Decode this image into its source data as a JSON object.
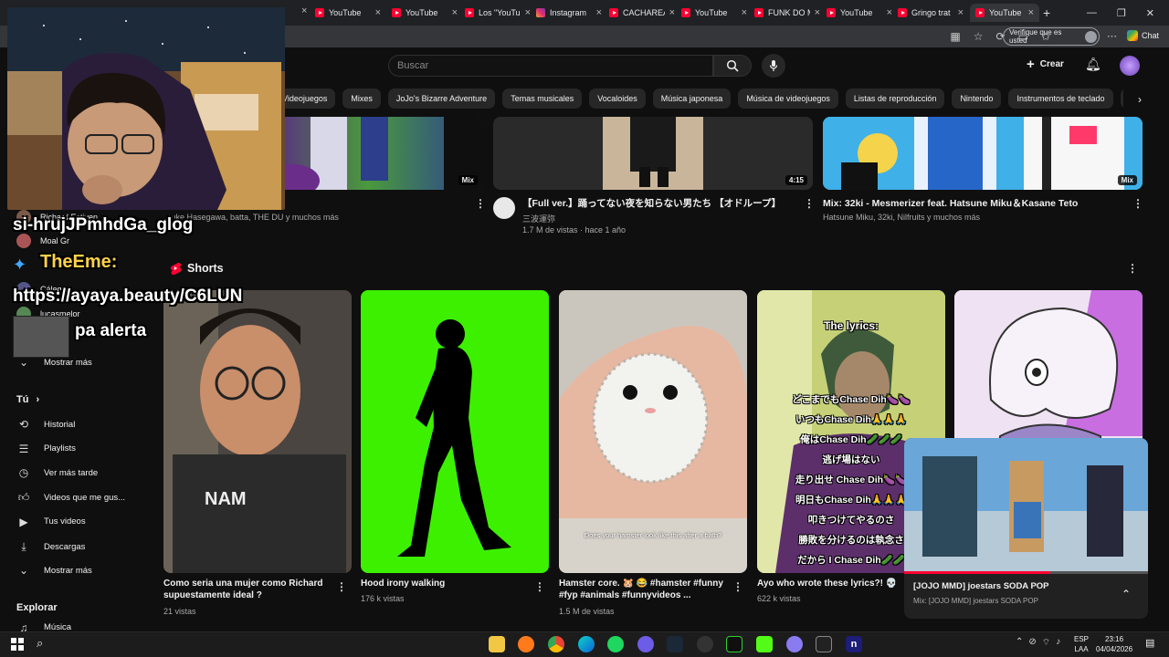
{
  "browser": {
    "tabs": [
      {
        "label": "YouTube",
        "favicon": "youtube-icon"
      },
      {
        "label": "YouTube",
        "favicon": "youtube-icon"
      },
      {
        "label": "Los \"YouTu",
        "favicon": "youtube-icon"
      },
      {
        "label": "Instagram",
        "favicon": "instagram-icon"
      },
      {
        "label": "CACHAREA",
        "favicon": "youtube-icon"
      },
      {
        "label": "YouTube",
        "favicon": "youtube-icon"
      },
      {
        "label": "FUNK DO M",
        "favicon": "youtube-icon"
      },
      {
        "label": "YouTube",
        "favicon": "youtube-icon"
      },
      {
        "label": "Gringo trat",
        "favicon": "youtube-icon"
      },
      {
        "label": "YouTube",
        "favicon": "youtube-icon"
      }
    ],
    "new_tab": "+",
    "verify_label": "Verifique que es usted",
    "chat_label": "Chat"
  },
  "youtube": {
    "search_placeholder": "Buscar",
    "create_label": "Crear",
    "chips": [
      "Videojuegos",
      "Mixes",
      "JoJo's Bizarre Adventure",
      "Temas musicales",
      "Vocaloides",
      "Música japonesa",
      "Música de videojuegos",
      "Listas de reproducción",
      "Nintendo",
      "Instrumentos de teclado",
      "H"
    ],
    "top_videos": [
      {
        "channel": "...uke Hasegawa, batta, THE DU y muchos más",
        "badge": "Mix"
      },
      {
        "title": "【Full ver.】踊ってない夜を知らない男たち 【オドループ】",
        "channel": "三波運弥",
        "meta": "1.7 M de vistas · hace 1 año",
        "badge": "4:15"
      },
      {
        "title": "Mix: 32ki - Mesmerizer feat. Hatsune Miku＆Kasane Teto",
        "channel": "Hatsune Miku, 32ki, Nilfruits y muchos más",
        "badge": "Mix"
      }
    ],
    "sidebar": {
      "subscriptions": [
        "Richard Estiven",
        "Moal Gr",
        "Cálego",
        "lucasmelor"
      ],
      "show_more_subs": "Mostrar más",
      "you_label": "Tú",
      "items": [
        {
          "label": "Historial",
          "icon": "history-icon"
        },
        {
          "label": "Playlists",
          "icon": "playlist-icon"
        },
        {
          "label": "Ver más tarde",
          "icon": "clock-icon"
        },
        {
          "label": "Videos que me gus...",
          "icon": "thumbs-up-icon"
        },
        {
          "label": "Tus videos",
          "icon": "video-icon"
        },
        {
          "label": "Descargas",
          "icon": "download-icon"
        },
        {
          "label": "Mostrar más",
          "icon": "chevron-down-icon"
        }
      ],
      "explore_label": "Explorar",
      "explore_items": [
        {
          "label": "Música",
          "icon": "music-icon"
        }
      ]
    },
    "shorts_title": "Shorts",
    "shorts": [
      {
        "title": "Como seria una mujer como Richard supuestamente ideal ?",
        "views": "21 vistas"
      },
      {
        "title": "Hood irony walking",
        "views": "176 k vistas"
      },
      {
        "title": "Hamster core. 🐹 😂 #hamster #funny #fyp #animals #funnyvideos ...",
        "views": "1.5 M de vistas",
        "caption": "Does your hamster look like this after a bath?"
      },
      {
        "title": "Ayo who wrote these lyrics?! 💀",
        "views": "622 k vistas",
        "caption_title": "The lyrics:",
        "lyrics": [
          "どこまでもChase Dih🍆🍆",
          "いつもChase Dih🙏🙏🙏",
          "俺はChase Dih🥒🥒🥒",
          "逃げ場はない",
          "走り出せ Chase Dih🍆🍆",
          "明日もChase Dih🙏🙏🙏",
          "叩きつけてやるのさ",
          "勝敗を分けるのは執念さ",
          "だから I Chase Dih🥒🥒"
        ]
      },
      {
        "title": "",
        "views": ""
      }
    ],
    "miniplayer": {
      "title": "[JOJO MMD] joestars SODA POP",
      "subtitle": "Mix: [JOJO MMD] joestars SODA POP",
      "progress": 0.6
    }
  },
  "stream_overlay": {
    "chat": [
      {
        "text": "si-hrujJPmhdGa_glog"
      },
      {
        "text": "TheEme:",
        "color": "#ffd24a"
      },
      {
        "text": "https://ayaya.beauty/C6LUN"
      },
      {
        "text": "pa alerta"
      }
    ]
  },
  "taskbar": {
    "lang_top": "ESP",
    "lang_bottom": "LAA",
    "time": "23:16",
    "date": "04/04/2026"
  }
}
